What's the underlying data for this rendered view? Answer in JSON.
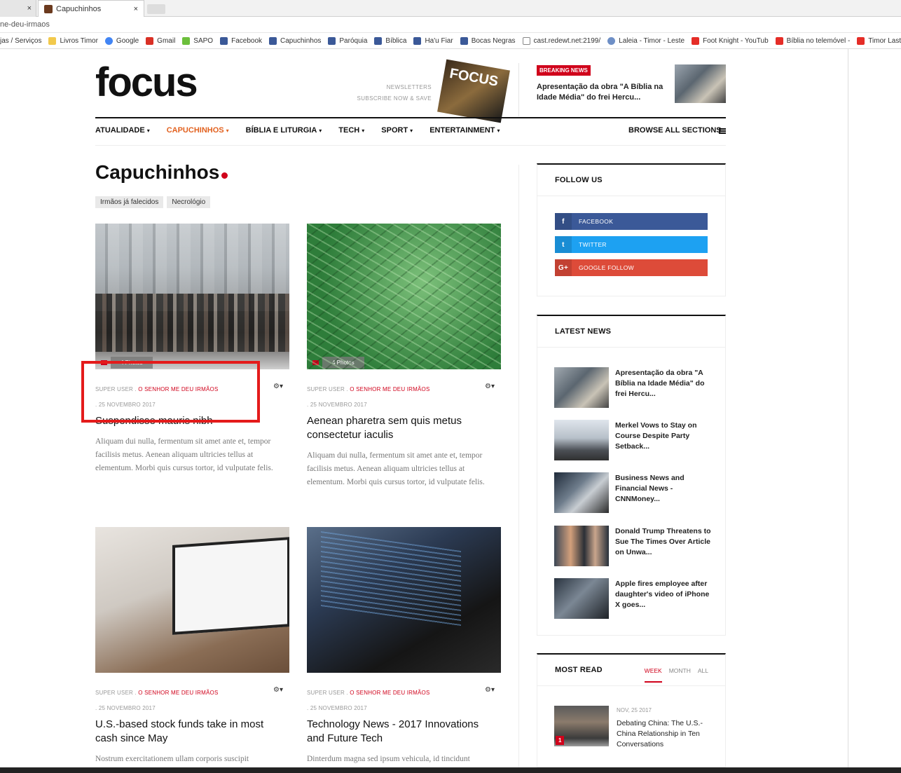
{
  "browser": {
    "prev_tab_close": "×",
    "active_tab_title": "Capuchinhos",
    "active_tab_close": "×",
    "url_fragment": "ne-deu-irmaos",
    "bookmarks": [
      {
        "label": "jas / Serviços",
        "icon": "none"
      },
      {
        "label": "Livros Timor",
        "icon": "folder"
      },
      {
        "label": "Google",
        "icon": "g"
      },
      {
        "label": "Gmail",
        "icon": "m"
      },
      {
        "label": "SAPO",
        "icon": "sapo"
      },
      {
        "label": "Facebook",
        "icon": "fb"
      },
      {
        "label": "Capuchinhos",
        "icon": "fb"
      },
      {
        "label": "Paróquia",
        "icon": "fb"
      },
      {
        "label": "Bíblica",
        "icon": "fb"
      },
      {
        "label": "Ha'u Fiar",
        "icon": "fb"
      },
      {
        "label": "Bocas Negras",
        "icon": "fb"
      },
      {
        "label": "cast.redewt.net:2199/",
        "icon": "doc"
      },
      {
        "label": "Laleia - Timor - Leste",
        "icon": "globe"
      },
      {
        "label": "Foot Knight - YouTub",
        "icon": "yt"
      },
      {
        "label": "Bíblia no telemóvel -",
        "icon": "yt"
      },
      {
        "label": "Timor Laste - YouT",
        "icon": "yt"
      }
    ]
  },
  "header": {
    "logo": "focus",
    "newsletter_line1": "NEWSLETTERS",
    "newsletter_line2": "SUBSCRIBE NOW & SAVE",
    "magazine_text": "FOCUS",
    "breaking_label": "BREAKING NEWS",
    "breaking_title": "Apresentação da obra \"A Bíblia na Idade Média\" do frei Hercu..."
  },
  "nav": {
    "items": [
      {
        "label": "ATUALIDADE",
        "caret": "▾"
      },
      {
        "label": "CAPUCHINHOS",
        "caret": "▾"
      },
      {
        "label": "BÍBLIA E LITURGIA",
        "caret": "▾"
      },
      {
        "label": "TECH",
        "caret": "▾"
      },
      {
        "label": "SPORT",
        "caret": "▾"
      },
      {
        "label": "ENTERTAINMENT",
        "caret": "▾"
      }
    ],
    "active_index": 1,
    "browse": "BROWSE ALL SECTIONS"
  },
  "page": {
    "title": "Capuchinhos",
    "subtags": [
      "Irmãos já falecidos",
      "Necrológio"
    ]
  },
  "articles": [
    {
      "photos": "4 Photos",
      "author": "SUPER USER .",
      "category": "O SENHOR ME DEU IRMÃOS",
      "date": ".  25 NOVEMBRO 2017",
      "title": "Suspendisse mauris nibh",
      "excerpt": "Aliquam dui nulla, fermentum sit amet ante et, tempor facilisis metus. Aenean aliquam ultricies tellus at elementum. Morbi quis cursus tortor, id vulputate felis."
    },
    {
      "photos": "4 Photos",
      "author": "SUPER USER .",
      "category": "O SENHOR ME DEU IRMÃOS",
      "date": ".  25 NOVEMBRO 2017",
      "title": "Aenean pharetra sem quis metus consectetur iaculis",
      "excerpt": "Aliquam dui nulla, fermentum sit amet ante et, tempor facilisis metus. Aenean aliquam ultricies tellus at elementum. Morbi quis cursus tortor, id vulputate felis."
    },
    {
      "author": "SUPER USER .",
      "category": "O SENHOR ME DEU IRMÃOS",
      "date": ".  25 NOVEMBRO 2017",
      "title": "U.S.-based stock funds take in most cash since May",
      "excerpt": "Nostrum exercitationem ullam corporis suscipit"
    },
    {
      "author": "SUPER USER .",
      "category": "O SENHOR ME DEU IRMÃOS",
      "date": ".  25 NOVEMBRO 2017",
      "title": "Technology News - 2017 Innovations and Future Tech",
      "excerpt": "Dinterdum magna sed ipsum vehicula, id tincidunt"
    }
  ],
  "sidebar": {
    "follow": {
      "title": "FOLLOW US",
      "facebook": "FACEBOOK",
      "twitter": "TWITTER",
      "google": "GOOGLE FOLLOW"
    },
    "latest": {
      "title": "LATEST NEWS",
      "items": [
        "Apresentação da obra \"A Bíblia na Idade Média\" do frei Hercu...",
        "Merkel Vows to Stay on Course Despite Party Setback...",
        "Business News and Financial News - CNNMoney...",
        "Donald Trump Threatens to Sue The Times Over Article on Unwa...",
        "Apple fires employee after daughter's video of iPhone X goes..."
      ]
    },
    "most_read": {
      "title": "MOST READ",
      "tabs": [
        "WEEK",
        "MONTH",
        "ALL"
      ],
      "item_date": "NOV, 25 2017",
      "item_rank": "1",
      "item_title": "Debating China: The U.S.-China Relationship in Ten Conversations"
    }
  },
  "colors": {
    "accent_red": "#d0021b",
    "nav_active": "#e2611f",
    "facebook": "#3b5998",
    "twitter": "#1da1f2",
    "google": "#dd4b39",
    "highlight_box": "#e41b1b"
  }
}
